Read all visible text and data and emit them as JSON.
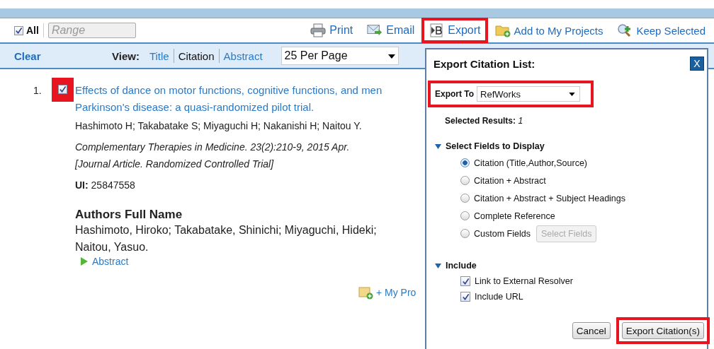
{
  "toolbar": {
    "select_all": {
      "label": "All",
      "checked": true
    },
    "range": {
      "placeholder": "Range"
    },
    "actions": [
      {
        "kind": "print",
        "label": "Print",
        "highlighted": false
      },
      {
        "kind": "email",
        "label": "Email",
        "highlighted": false
      },
      {
        "kind": "export",
        "label": "Export",
        "highlighted": true
      },
      {
        "kind": "projects",
        "label": "Add to My Projects",
        "highlighted": false
      },
      {
        "kind": "keep",
        "label": "Keep Selected",
        "highlighted": false
      }
    ]
  },
  "view_bar": {
    "clear": "Clear",
    "view_label": "View:",
    "views": [
      {
        "label": "Title",
        "selected": false
      },
      {
        "label": "Citation",
        "selected": true
      },
      {
        "label": "Abstract",
        "selected": false
      }
    ],
    "per_page": "25 Per Page"
  },
  "result": {
    "number": "1.",
    "checked": true,
    "highlighted": true,
    "title_lines": [
      "Effects of dance on motor functions, cognitive functions, and men",
      "Parkinson's disease: a quasi-randomized pilot trial."
    ],
    "authors": "Hashimoto H; Takabatake S; Miyaguchi H; Nakanishi H; Naitou Y.",
    "source": "Complementary Therapies in Medicine. 23(2):210-9, 2015 Apr.",
    "pub_type": "[Journal Article. Randomized Controlled Trial]",
    "ui_label": "UI:",
    "ui": "25847558",
    "full_name_heading": "Authors Full Name",
    "full_name_lines": [
      "Hashimoto, Hiroko; Takabatake, Shinichi; Miyaguchi, Hideki;",
      "Naitou, Yasuo."
    ],
    "abstract_link": "Abstract",
    "my_projects": "+ My Pro"
  },
  "dialog": {
    "title": "Export Citation List:",
    "close": "X",
    "export_to": {
      "label": "Export To",
      "value": "RefWorks",
      "highlighted": true
    },
    "selected_results": {
      "label": "Selected Results:",
      "value": "1"
    },
    "fields_section": {
      "title": "Select Fields to Display",
      "expanded": true,
      "options": [
        {
          "label": "Citation (Title,Author,Source)",
          "selected": true
        },
        {
          "label": "Citation + Abstract",
          "selected": false
        },
        {
          "label": "Citation + Abstract + Subject Headings",
          "selected": false
        },
        {
          "label": "Complete Reference",
          "selected": false
        },
        {
          "label": "Custom Fields",
          "selected": false,
          "button": "Select Fields",
          "button_disabled": true
        }
      ]
    },
    "include_section": {
      "title": "Include",
      "expanded": true,
      "options": [
        {
          "label": "Link to External Resolver",
          "checked": true
        },
        {
          "label": "Include URL",
          "checked": true
        }
      ]
    },
    "buttons": [
      {
        "label": "Cancel",
        "highlighted": false
      },
      {
        "label": "Export Citation(s)",
        "highlighted": true
      }
    ]
  }
}
